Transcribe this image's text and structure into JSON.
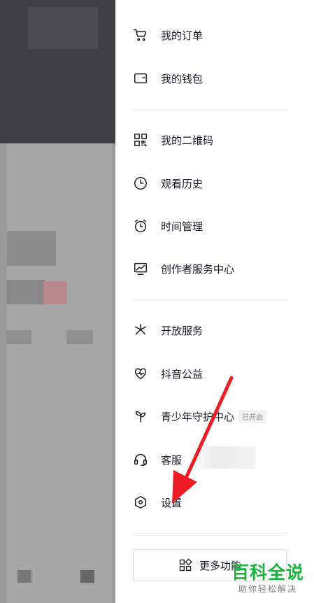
{
  "menu": {
    "orders": "我的订单",
    "wallet": "我的钱包",
    "qrcode": "我的二维码",
    "history": "观看历史",
    "time_management": "时间管理",
    "creator_center": "创作者服务中心",
    "open_services": "开放服务",
    "charity": "抖音公益",
    "youth_mode": "青少年守护中心",
    "youth_badge": "已开启",
    "customer_service": "客服",
    "settings": "设置"
  },
  "more_button": {
    "label": "更多功能"
  },
  "watermark": {
    "title": "百科全说",
    "subtitle": "助你轻松解决"
  },
  "colors": {
    "arrow": "#ee1c25",
    "watermark": "#19b33c"
  }
}
